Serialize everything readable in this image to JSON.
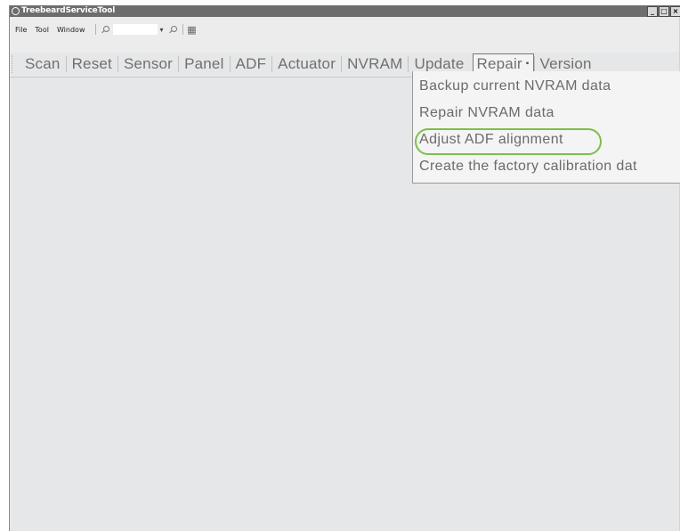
{
  "window": {
    "title": "TreebeardServiceTool",
    "controls": {
      "minimize": "_",
      "maximize": "□",
      "close": "×"
    }
  },
  "menubar": {
    "items": [
      {
        "label": "File",
        "accel": "F"
      },
      {
        "label": "Tool",
        "accel": "T"
      },
      {
        "label": "Window",
        "accel": "W"
      }
    ],
    "icons": [
      "search-icon",
      "zoom-in-icon",
      "fit-icon"
    ],
    "zoom_value": ""
  },
  "tabs": [
    {
      "label": "Scan"
    },
    {
      "label": "Reset"
    },
    {
      "label": "Sensor"
    },
    {
      "label": "Panel"
    },
    {
      "label": "ADF"
    },
    {
      "label": "Actuator"
    },
    {
      "label": "NVRAM"
    },
    {
      "label": "Update"
    },
    {
      "label": "Repair",
      "active": true
    },
    {
      "label": "Version"
    }
  ],
  "repair_menu": {
    "items": [
      {
        "label": "Backup current NVRAM data"
      },
      {
        "label": "Repair NVRAM data"
      },
      {
        "label": "Adjust ADF alignment",
        "highlighted": true
      },
      {
        "label": "Create the factory calibration dat"
      }
    ],
    "highlight_color": "#7cbf4b"
  },
  "colors": {
    "titlebar": "#6d6d6d",
    "workspace": "#e6e7e8",
    "text": "#707070"
  }
}
